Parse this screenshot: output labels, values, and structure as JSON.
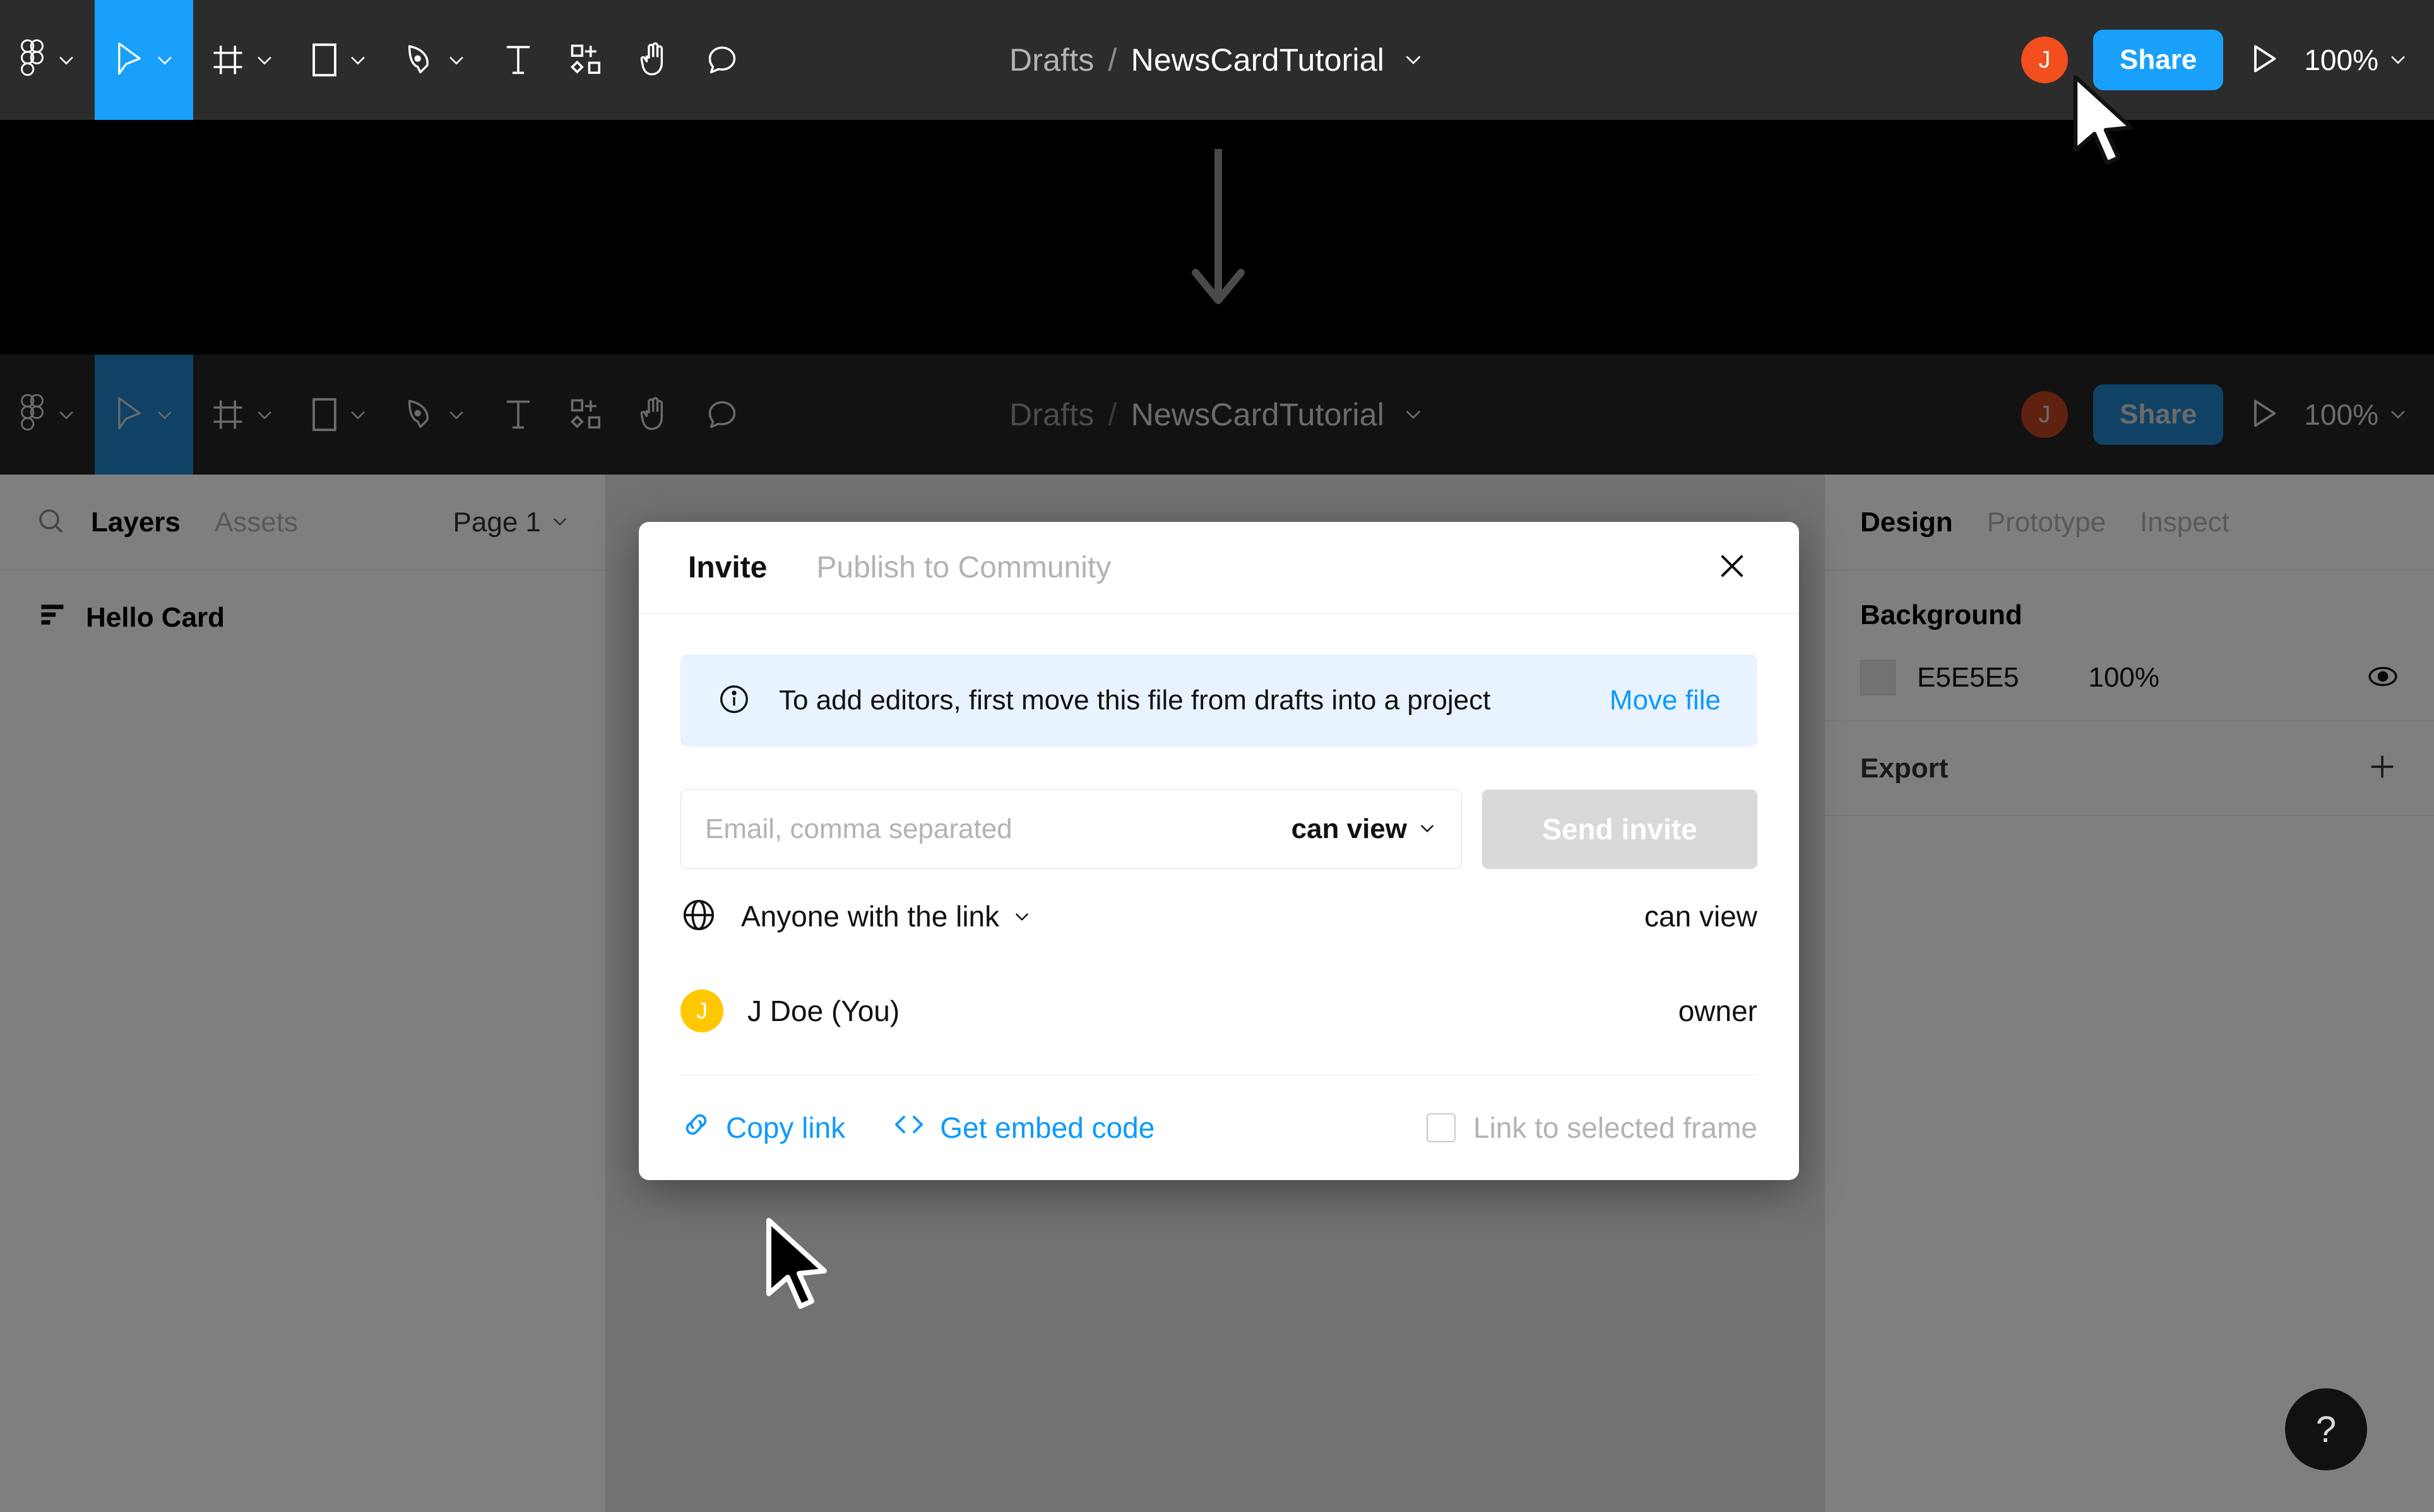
{
  "toolbar": {
    "tools": [
      {
        "name": "figma-logo-icon",
        "label": "Figma",
        "has_chevron": true,
        "active": false
      },
      {
        "name": "move-tool-icon",
        "label": "Move",
        "has_chevron": true,
        "active": true
      },
      {
        "name": "frame-tool-icon",
        "label": "Frame",
        "has_chevron": true,
        "active": false
      },
      {
        "name": "shape-tool-icon",
        "label": "Rectangle",
        "has_chevron": true,
        "active": false
      },
      {
        "name": "pen-tool-icon",
        "label": "Pen",
        "has_chevron": true,
        "active": false
      },
      {
        "name": "text-tool-icon",
        "label": "Text",
        "has_chevron": false,
        "active": false
      },
      {
        "name": "resources-tool-icon",
        "label": "Resources",
        "has_chevron": false,
        "active": false
      },
      {
        "name": "hand-tool-icon",
        "label": "Hand",
        "has_chevron": false,
        "active": false
      },
      {
        "name": "comment-tool-icon",
        "label": "Comment",
        "has_chevron": false,
        "active": false
      }
    ],
    "breadcrumb_project": "Drafts",
    "breadcrumb_separator": "/",
    "breadcrumb_file": "NewsCardTutorial",
    "avatar_initial": "J",
    "share_label": "Share",
    "present_icon": "present-play-icon",
    "zoom_level": "100%"
  },
  "left_panel": {
    "search_icon": "search-icon",
    "tabs": [
      {
        "label": "Layers",
        "selected": true
      },
      {
        "label": "Assets",
        "selected": false
      }
    ],
    "page_selector": "Page 1",
    "layers": [
      {
        "label": "Hello Card",
        "icon": "frame-layer-icon"
      }
    ]
  },
  "right_panel": {
    "tabs": [
      {
        "label": "Design",
        "selected": true
      },
      {
        "label": "Prototype",
        "selected": false
      },
      {
        "label": "Inspect",
        "selected": false
      }
    ],
    "background": {
      "title": "Background",
      "hex": "E5E5E5",
      "opacity": "100%",
      "swatch_color": "#E5E5E5",
      "visibility_icon": "eye-icon"
    },
    "export": {
      "title": "Export",
      "add_icon": "plus-icon"
    }
  },
  "dialog": {
    "tabs": [
      {
        "label": "Invite",
        "selected": true
      },
      {
        "label": "Publish to Community",
        "selected": false
      }
    ],
    "close_icon": "close-icon",
    "notice": {
      "icon": "info-icon",
      "text": "To add editors, first move this file from drafts into a project",
      "link": "Move file"
    },
    "invite": {
      "email_placeholder": "Email, comma separated",
      "email_value": "",
      "permission": "can view",
      "send_label": "Send invite",
      "send_disabled": true
    },
    "access_rows": [
      {
        "icon": "globe-icon",
        "label": "Anyone with the link",
        "has_chevron": true,
        "right": "can view",
        "avatar": null
      },
      {
        "icon": null,
        "label": "J Doe (You)",
        "has_chevron": false,
        "right": "owner",
        "avatar": "J",
        "avatar_color": "#FFC700"
      }
    ],
    "footer": {
      "copy_link_icon": "link-icon",
      "copy_link": "Copy link",
      "embed_icon": "code-brackets-icon",
      "embed_label": "Get embed code",
      "checkbox_label": "Link to selected frame",
      "checkbox_checked": false
    }
  },
  "annotation": {
    "arrow_icon": "down-arrow-annotation"
  },
  "help": {
    "label": "?",
    "icon": "help-question-icon"
  },
  "colors": {
    "accent_blue": "#18A0FB",
    "link_blue": "#0D99FF",
    "toolbar_bg": "#2C2C2C",
    "avatar_red": "#F24E1E",
    "avatar_yellow": "#FFC700",
    "canvas_bg": "#E5E5E5"
  }
}
